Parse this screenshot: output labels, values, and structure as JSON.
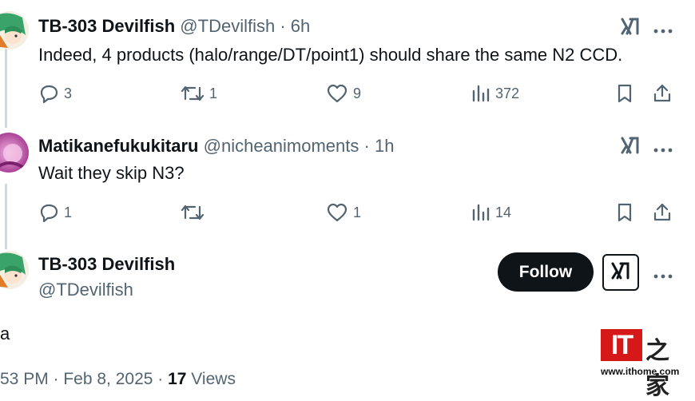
{
  "tweets": [
    {
      "name": "TB-303 Devilfish",
      "handle": "@TDevilfish",
      "separator": "·",
      "time": "6h",
      "text": "Indeed, 4 products (halo/range/DT/point1) should share the same N2 CCD.",
      "replies": "3",
      "reposts": "1",
      "likes": "9",
      "views": "372"
    },
    {
      "name": "Matikanefukukitaru",
      "handle": "@nicheanimoments",
      "separator": "·",
      "time": "1h",
      "text": "Wait they skip N3?",
      "replies": "1",
      "reposts": "",
      "likes": "1",
      "views": "14"
    }
  ],
  "main_post": {
    "name": "TB-303 Devilfish",
    "handle": "@TDevilfish",
    "follow_label": "Follow",
    "text": "a",
    "time_prefix": "53 PM · Feb 8, 2025 · ",
    "view_count": "17",
    "views_label": " Views"
  },
  "watermark": {
    "logo_text": "IT",
    "cn_text": "之家",
    "url": "www.ithome.com"
  },
  "icons": {
    "reply": "reply-icon",
    "repost": "repost-icon",
    "like": "heart-icon",
    "views": "analytics-icon",
    "bookmark": "bookmark-icon",
    "share": "share-icon",
    "grok": "grok-icon",
    "more": "more-icon"
  },
  "colors": {
    "text": "#0f1419",
    "secondary": "#536471",
    "thread_line": "#cfd9de",
    "follow_bg": "#0f1419",
    "watermark_red": "#d71818"
  }
}
